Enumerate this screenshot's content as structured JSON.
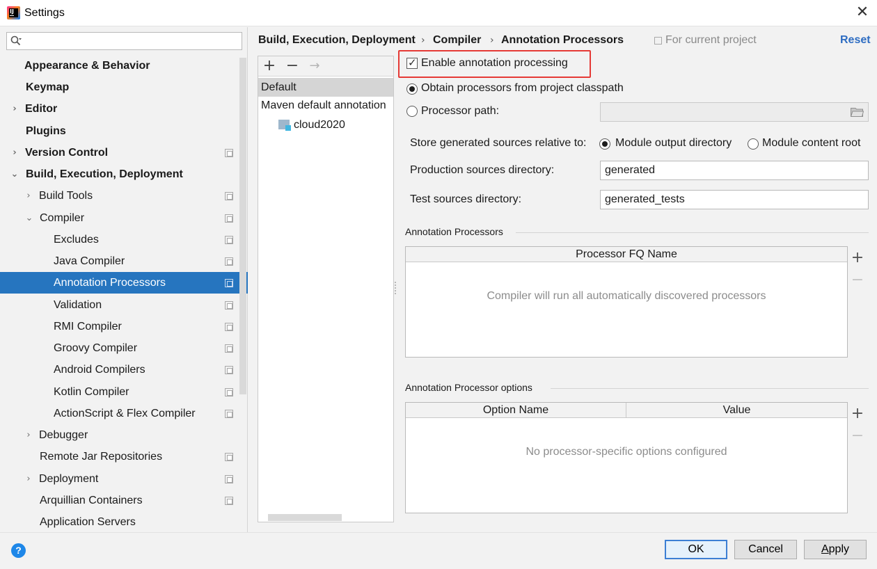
{
  "window": {
    "title": "Settings",
    "close_glyph": "✕"
  },
  "search": {
    "placeholder": ""
  },
  "sidebar": {
    "items": [
      {
        "label": "Appearance & Behavior",
        "bold": true
      },
      {
        "label": "Keymap",
        "bold": true
      },
      {
        "label": "Editor",
        "bold": true
      },
      {
        "label": "Plugins",
        "bold": true
      },
      {
        "label": "Version Control",
        "bold": true
      },
      {
        "label": "Build, Execution, Deployment",
        "bold": true
      },
      {
        "label": "Build Tools"
      },
      {
        "label": "Compiler"
      },
      {
        "label": "Excludes"
      },
      {
        "label": "Java Compiler"
      },
      {
        "label": "Annotation Processors",
        "selected": true
      },
      {
        "label": "Validation"
      },
      {
        "label": "RMI Compiler"
      },
      {
        "label": "Groovy Compiler"
      },
      {
        "label": "Android Compilers"
      },
      {
        "label": "Kotlin Compiler"
      },
      {
        "label": "ActionScript & Flex Compiler"
      },
      {
        "label": "Debugger"
      },
      {
        "label": "Remote Jar Repositories"
      },
      {
        "label": "Deployment"
      },
      {
        "label": "Arquillian Containers"
      },
      {
        "label": "Application Servers"
      }
    ]
  },
  "breadcrumb": {
    "part1": "Build, Execution, Deployment",
    "part2": "Compiler",
    "part3": "Annotation Processors",
    "separator": "›"
  },
  "header": {
    "for_current_project": "For current project",
    "reset": "Reset"
  },
  "profiles": {
    "add": "+",
    "remove": "−",
    "move": "→",
    "items": [
      "Default",
      "Maven default annotation"
    ],
    "module": "cloud2020"
  },
  "options": {
    "enable_annotation_processing": "Enable annotation processing",
    "enable_checked": true,
    "obtain_from_classpath": "Obtain processors from project classpath",
    "processor_path": "Processor path:",
    "store_relative_to": "Store generated sources relative to:",
    "module_output_directory": "Module output directory",
    "module_content_root": "Module content root",
    "production_sources_label": "Production sources directory:",
    "production_sources_value": "generated",
    "test_sources_label": "Test sources directory:",
    "test_sources_value": "generated_tests"
  },
  "processors_table": {
    "group_title": "Annotation Processors",
    "column": "Processor FQ Name",
    "empty_text": "Compiler will run all automatically discovered processors"
  },
  "options_table": {
    "group_title": "Annotation Processor options",
    "columns": [
      "Option Name",
      "Value"
    ],
    "empty_text": "No processor-specific options configured"
  },
  "footer": {
    "help": "?",
    "ok": "OK",
    "cancel": "Cancel",
    "apply_underlined": "A",
    "apply_rest": "pply"
  },
  "colors": {
    "selection": "#2675bf",
    "highlight_border": "#e53935",
    "link": "#2e6dc2"
  }
}
